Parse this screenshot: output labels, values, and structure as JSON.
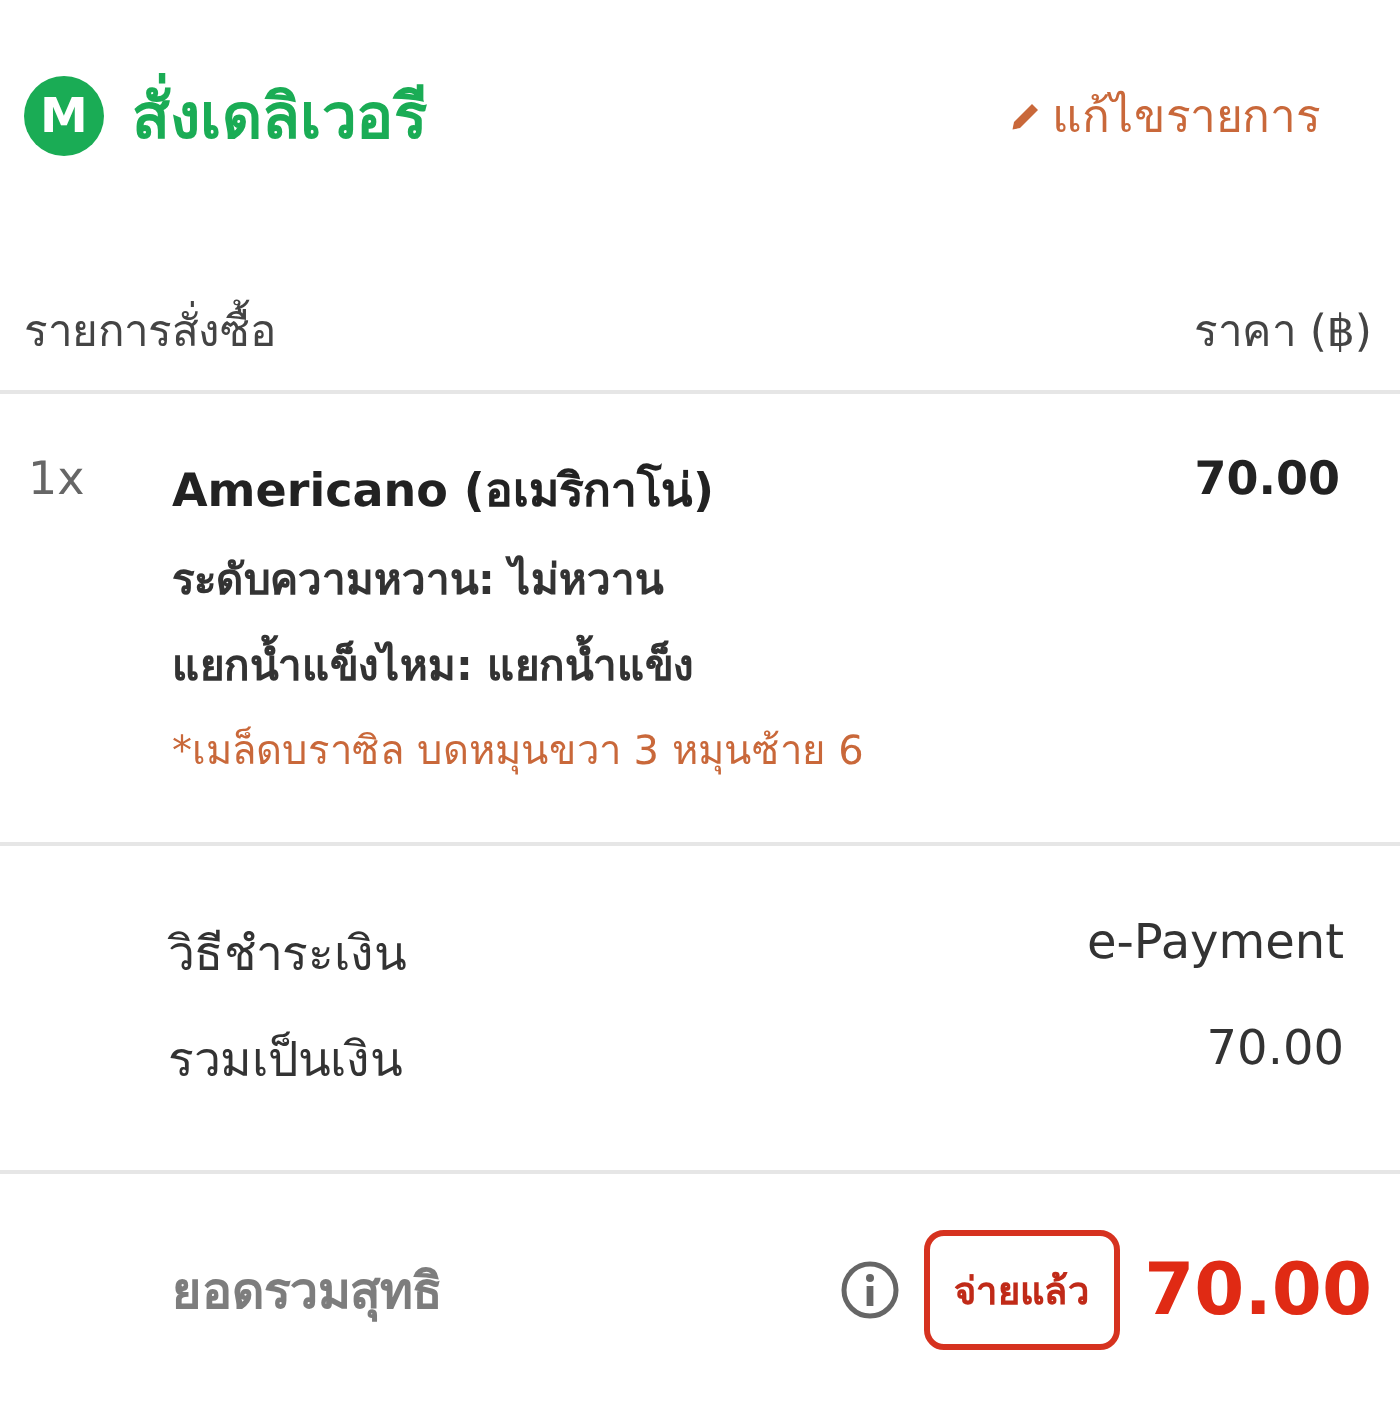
{
  "header": {
    "logo": "M",
    "title": "สั่งเดลิเวอรี",
    "edit_link": "แก้ไขรายการ"
  },
  "columns": {
    "items": "รายการสั่งซื้อ",
    "price": "ราคา (฿)"
  },
  "items": [
    {
      "quantity": "1x",
      "name": "Americano (อเมริกาโน่)",
      "price": "70.00",
      "options": [
        "ระดับความหวาน: ไม่หวาน",
        "แยกน้ำแข็งไหม: แยกน้ำแข็ง"
      ],
      "note": "*เมล็ดบราซิล บดหมุนขวา 3 หมุนซ้าย 6"
    }
  ],
  "summary": [
    {
      "label": "วิธีชำระเงิน",
      "value": "e-Payment"
    },
    {
      "label": "รวมเป็นเงิน",
      "value": "70.00"
    }
  ],
  "total": {
    "label": "ยอดรวมสุทธิ",
    "status": "จ่ายแล้ว",
    "amount": "70.00"
  }
}
